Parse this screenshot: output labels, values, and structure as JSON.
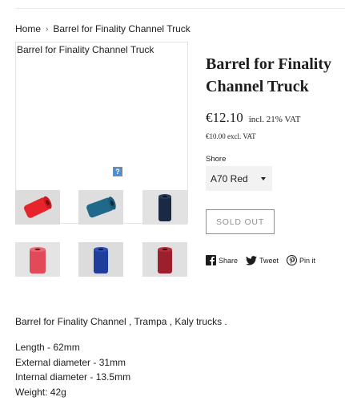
{
  "breadcrumb": {
    "home": "Home",
    "separator": "›",
    "current": "Barrel for Finality Channel Truck"
  },
  "product": {
    "image_alt": "Barrel for Finality Channel Truck",
    "broken_image_glyph": "?",
    "thumbnails": [
      {
        "name": "red bushing",
        "color": "#e8242b"
      },
      {
        "name": "teal blue bushing",
        "color": "#1f6a8a"
      },
      {
        "name": "dark navy bushing",
        "color": "#1b2a44"
      },
      {
        "name": "pink red bushing",
        "color": "#e24a5a"
      },
      {
        "name": "royal blue bushing",
        "color": "#1f3d9a"
      },
      {
        "name": "maroon bushing",
        "color": "#9c1f2e"
      }
    ],
    "title": "Barrel for Finality Channel Truck",
    "price": "€12.10",
    "vat_note": "incl. 21% VAT",
    "price_excl": "€10.00 excl. VAT",
    "shore_label": "Shore",
    "shore_value": "A70 Red",
    "sold_out_label": "Sold out"
  },
  "share": {
    "facebook_label": "Share",
    "twitter_label": "Tweet",
    "pinterest_label": "Pin it"
  },
  "description": {
    "intro": "Barrel for Finality Channel , Trampa , Kaly trucks .",
    "specs": [
      "Length - 62mm",
      "External diameter - 31mm",
      "Internal diameter - 13.5mm",
      "Weight: 42g"
    ]
  },
  "colors": {
    "text": "#1c1d1d",
    "muted_border": "#8f8f8f",
    "select_bg": "#f2f2f2"
  }
}
